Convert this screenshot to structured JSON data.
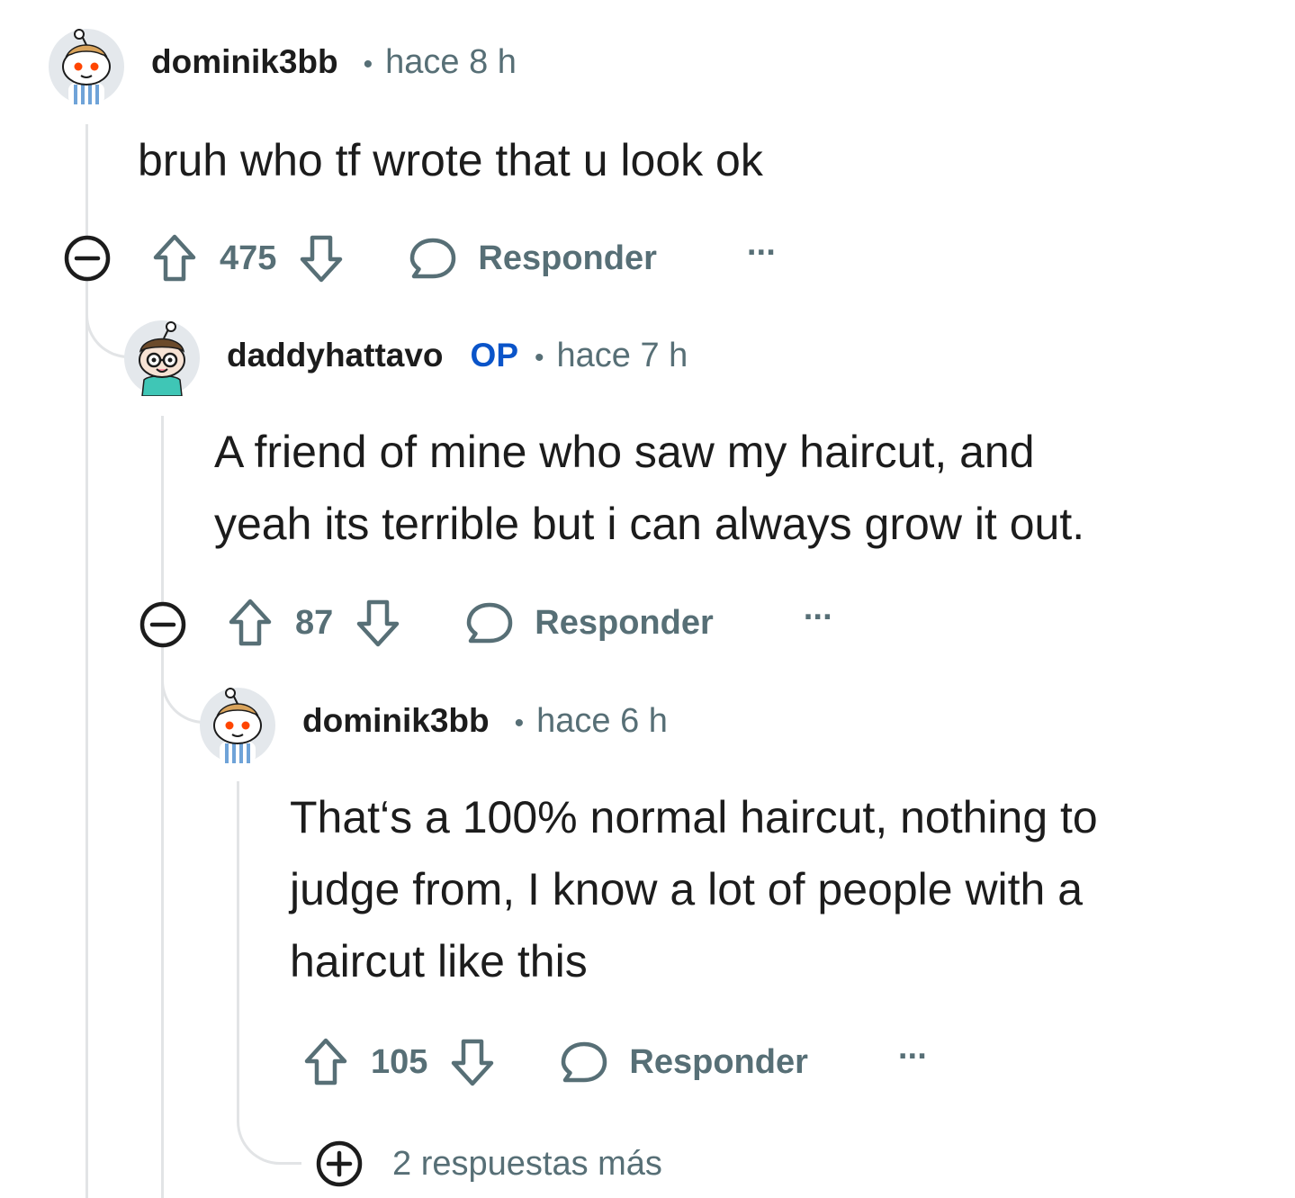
{
  "comments": [
    {
      "username": "dominik3bb",
      "time": "hace 8 h",
      "body": "bruh who tf wrote that u look ok",
      "score": "475",
      "reply_label": "Responder",
      "more_label": "···",
      "avatar_icon": "snoo-avatar-blue-shirt"
    },
    {
      "username": "daddyhattavo",
      "op_badge": "OP",
      "time": "hace 7 h",
      "body_lines": [
        "A friend of mine who saw my haircut, and",
        "yeah its terrible but i can always grow it out."
      ],
      "score": "87",
      "reply_label": "Responder",
      "more_label": "···",
      "avatar_icon": "snoo-avatar-glasses-teal-shirt"
    },
    {
      "username": "dominik3bb",
      "time": "hace 6 h",
      "body_lines": [
        "That‘s a 100% normal haircut, nothing to",
        "judge from, I know a lot of people with a",
        "haircut like this"
      ],
      "score": "105",
      "reply_label": "Responder",
      "more_label": "···",
      "avatar_icon": "snoo-avatar-blue-shirt"
    }
  ],
  "meta_separator": "•",
  "more_replies_label": "2 respuestas más",
  "colors": {
    "text": "#1c1c1c",
    "muted": "#576f76",
    "op": "#0a54c9",
    "thread": "#e2e4e6"
  }
}
